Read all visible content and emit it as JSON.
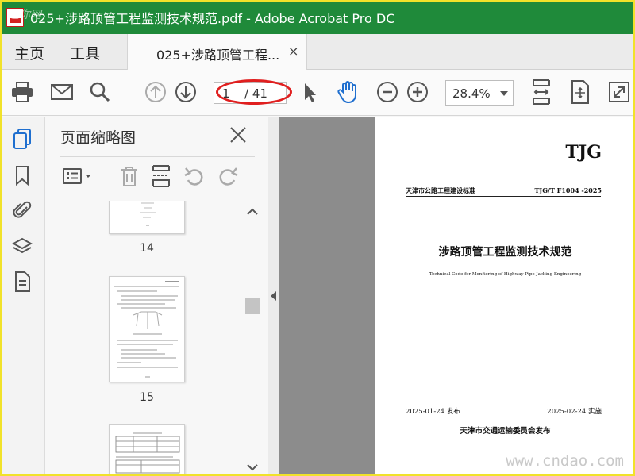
{
  "window": {
    "title": "025+涉路顶管工程监测技术规范.pdf - Adobe Acrobat Pro DC",
    "corner_watermark": "迷你网"
  },
  "tabs": {
    "home": "主页",
    "tools": "工具",
    "document": "025+涉路顶管工程...",
    "close_symbol": "×"
  },
  "toolbar": {
    "icons": [
      "print-icon",
      "email-icon",
      "search-icon",
      "page-up-icon",
      "page-down-icon",
      "select-arrow-icon",
      "hand-tool-icon",
      "zoom-out-icon",
      "zoom-in-icon",
      "fit-width-icon",
      "fit-page-icon",
      "fullscreen-icon"
    ],
    "current_page": "1",
    "total_pages": "/ 41",
    "zoom": "28.4%"
  },
  "sidebar": {
    "icons": [
      "page-thumbnails-icon",
      "bookmark-icon",
      "attachment-icon",
      "layers-icon",
      "document-icon"
    ]
  },
  "thumbnails_panel": {
    "title": "页面缩略图",
    "pages": [
      {
        "number": "14"
      },
      {
        "number": "15"
      }
    ]
  },
  "document": {
    "mark": "TJG",
    "standard_left": "天津市公路工程建设标准",
    "standard_right": "TJG/T F1004 -2025",
    "title": "涉路顶管工程监测技术规范",
    "subtitle": "Technical Code for Monitoring of Highway Pipe Jacking Engineering",
    "issue_date": "2025-01-24 发布",
    "effective_date": "2025-02-24 实施",
    "publisher": "天津市交通运输委员会发布"
  },
  "watermark": "www.cndao.com",
  "colors": {
    "titlebar": "#1f8a3a",
    "highlight": "#e01f1f",
    "frame": "#f1e22a"
  }
}
